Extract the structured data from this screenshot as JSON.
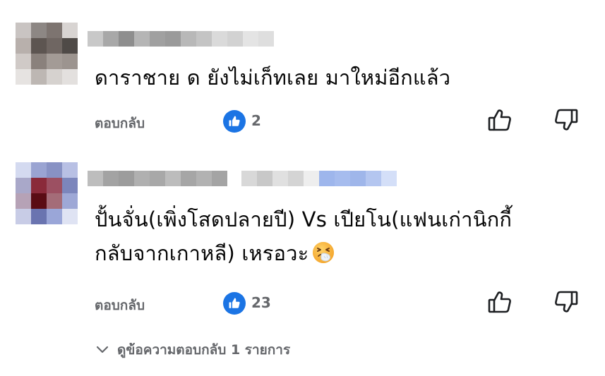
{
  "comments": [
    {
      "text_lines": [
        "ดาราชาย ด  ยังไม่เก็ทเลย มาใหม่อีกแล้ว"
      ],
      "reply_label": "ตอบกลับ",
      "like_count": "2"
    },
    {
      "text_lines": [
        "ปั้นจั่น(เพิ่งโสดปลายปี) Vs เปียโน(แฟนเก่านิกกี้",
        "กลับจากเกาหลี) เหรอวะ"
      ],
      "emoji": "sneezing-face-icon",
      "reply_label": "ตอบกลับ",
      "like_count": "23"
    }
  ],
  "view_replies_label": "ดูข้อความตอบกลับ 1 รายการ",
  "colors": {
    "like_badge": "#1b74e4",
    "secondary_text": "#65676b",
    "primary_text": "#050505"
  }
}
